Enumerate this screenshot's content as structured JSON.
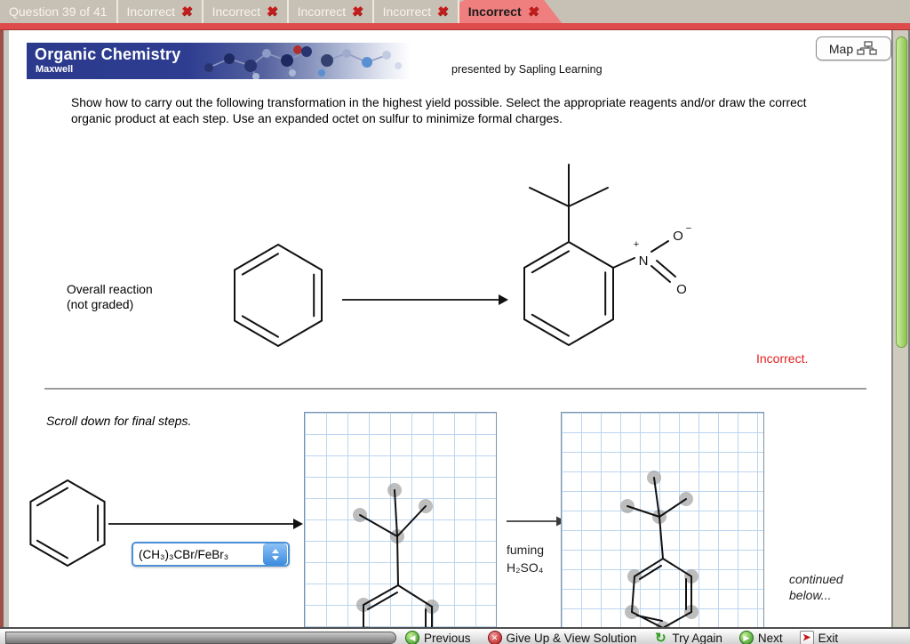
{
  "window": {
    "tab_bar": {
      "question_tab": "Question 39 of 41",
      "tabs": [
        {
          "label": "Incorrect",
          "active": false
        },
        {
          "label": "Incorrect",
          "active": false
        },
        {
          "label": "Incorrect",
          "active": false
        },
        {
          "label": "Incorrect",
          "active": false
        },
        {
          "label": "Incorrect",
          "active": true
        }
      ]
    }
  },
  "header": {
    "banner_title": "Organic Chemistry",
    "banner_subtitle": "Maxwell",
    "presented_by": "presented by Sapling Learning",
    "map_button_label": "Map"
  },
  "question_text": "Show how to carry out the following transformation in the highest yield possible.  Select the appropriate reagents and/or draw the correct organic product at each step. Use an expanded octet on sulfur to minimize formal charges.",
  "overall_reaction": {
    "label_line1": "Overall reaction",
    "label_line2": "(not graded)",
    "feedback": "Incorrect."
  },
  "product_labels": {
    "n": "N",
    "plus": "+",
    "o_top": "O",
    "minus": "−",
    "o_bottom": "O"
  },
  "scroll_note": "Scroll down for final steps.",
  "step_section": {
    "reagent_value": "(CH₃)₃CBr/FeBr₃",
    "arrow_label_line1": "fuming",
    "arrow_label_line2": "H₂SO₄",
    "continued_line1": "continued",
    "continued_line2": "below..."
  },
  "footer": {
    "buttons": [
      {
        "label": "Previous"
      },
      {
        "label": "Give Up & View Solution"
      },
      {
        "label": "Try Again"
      },
      {
        "label": "Next"
      },
      {
        "label": "Exit"
      }
    ]
  },
  "colors": {
    "active_tab": "#ef7f7f",
    "strip_red": "#de4b4b",
    "banner_navy": "#2b3a8c",
    "incorrect_red": "#e02020",
    "grid_blue": "#bcd5ef",
    "dropdown_blue": "#4a90d9",
    "scrollbar_green": "#8dc452"
  }
}
